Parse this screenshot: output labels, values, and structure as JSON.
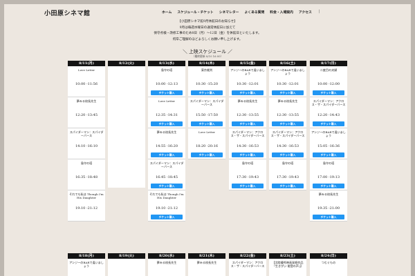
{
  "site": {
    "title": "小田原シネマ館"
  },
  "nav": [
    "ホーム",
    "スケジュール・チケット",
    "シネマレター",
    "よくある質問",
    "料金・入場案内",
    "アクセス",
    "⋮"
  ],
  "notice": {
    "lines": [
      "【小田原シネマ館9月休館日のお知らせ】",
      "9月は毎週水曜日の通常休館日に加えて",
      "保守点検・改修工事のため8日（月）〜12日（金）を休館日といたします。",
      "何卒ご理解のほどよろしくお願い申し上げます。"
    ]
  },
  "schedule": {
    "title": "上映スケジュール",
    "subtitle": "（最終更新 8/10 16:00）"
  },
  "ticket_label": "チケット購入",
  "days": [
    {
      "date": "8/11(月)",
      "films": [
        {
          "title": "Love Letter",
          "time": "10:00 -11:56",
          "ticket": false
        },
        {
          "title": "夢みる校長先生",
          "time": "12:20 -13:45",
          "ticket": false
        },
        {
          "title": "スパイダーマン：スパイダーバース",
          "time": "14:10 -16:10",
          "ticket": false
        },
        {
          "title": "島守の塔",
          "time": "16:35 -18:48",
          "ticket": false
        },
        {
          "title": "それでも私は Though I'm His Daughter",
          "time": "19:10 -21:12",
          "ticket": false
        }
      ]
    },
    {
      "date": "8/12(火)",
      "films": []
    },
    {
      "date": "8/13(水)",
      "films": [
        {
          "title": "島守の塔",
          "time": "10:00 -12:13",
          "ticket": true
        },
        {
          "title": "Love Letter",
          "time": "12:35 -14:31",
          "ticket": true
        },
        {
          "title": "夢みる校長先生",
          "time": "14:55 -16:20",
          "ticket": true
        },
        {
          "title": "スパイダーマン：スパイダーバース",
          "time": "16:45 -18:45",
          "ticket": true
        },
        {
          "title": "それでも私は Though I'm His Daughter",
          "time": "19:10 -21:12",
          "ticket": true
        }
      ]
    },
    {
      "date": "8/14(木)",
      "films": [
        {
          "title": "東京裁判",
          "time": "10:30 -15:20",
          "ticket": true
        },
        {
          "title": "スパイダーマン：スパイダーバース",
          "time": "15:50 -17:50",
          "ticket": true
        },
        {
          "title": "Love Letter",
          "time": "18:20 -20:16",
          "ticket": true
        }
      ]
    },
    {
      "date": "8/15(金)",
      "films": [
        {
          "title": "アンジーのBARで逢いましょう",
          "time": "10:30 -12:01",
          "ticket": true
        },
        {
          "title": "夢みる校長先生",
          "time": "12:30 -13:55",
          "ticket": true
        },
        {
          "title": "スパイダーマン：アクロス・ザ・スパイダーバース",
          "time": "14:30 -16:53",
          "ticket": true
        },
        {
          "title": "島守の塔",
          "time": "17:30 -19:43",
          "ticket": true
        }
      ]
    },
    {
      "date": "8/16(土)",
      "films": [
        {
          "title": "アンジーのBARで逢いましょう",
          "time": "10:30 -12:01",
          "ticket": true
        },
        {
          "title": "夢みる校長先生",
          "time": "12:30 -13:55",
          "ticket": true
        },
        {
          "title": "スパイダーマン：アクロス・ザ・スパイダーバース",
          "time": "14:30 -16:53",
          "ticket": true
        },
        {
          "title": "島守の塔",
          "time": "17:30 -19:43",
          "ticket": true
        }
      ]
    },
    {
      "date": "8/17(日)",
      "films": [
        {
          "title": "二度目の夫婦",
          "time": "10:00 -12:00",
          "ticket": true
        },
        {
          "title": "スパイダーマン：アクロス・ザ・スパイダーバース",
          "time": "12:20 -14:43",
          "ticket": true
        },
        {
          "title": "アンジーのBARで逢いましょう",
          "time": "15:05 -16:36",
          "ticket": true
        },
        {
          "title": "島守の塔",
          "time": "17:00 -19:13",
          "ticket": true
        },
        {
          "title": "夢みる校長先生",
          "time": "19:35 -21:00",
          "ticket": true
        }
      ]
    }
  ],
  "days2": [
    {
      "date": "8/18(月)",
      "film": "アンジーのBARで逢いましょう"
    },
    {
      "date": "8/19(火)",
      "film": ""
    },
    {
      "date": "8/20(水)",
      "film": "夢みる校長先生"
    },
    {
      "date": "8/21(木)",
      "film": "夢みる校長先生"
    },
    {
      "date": "8/22(金)",
      "film": "スパイダーマン：アクロス・ザ・スパイダーバース"
    },
    {
      "date": "8/23(土)",
      "film": "【北陸優秀映画発掘作品「生きがい 能登の声」】"
    },
    {
      "date": "8/24(日)",
      "film": "つむぐもの"
    }
  ]
}
